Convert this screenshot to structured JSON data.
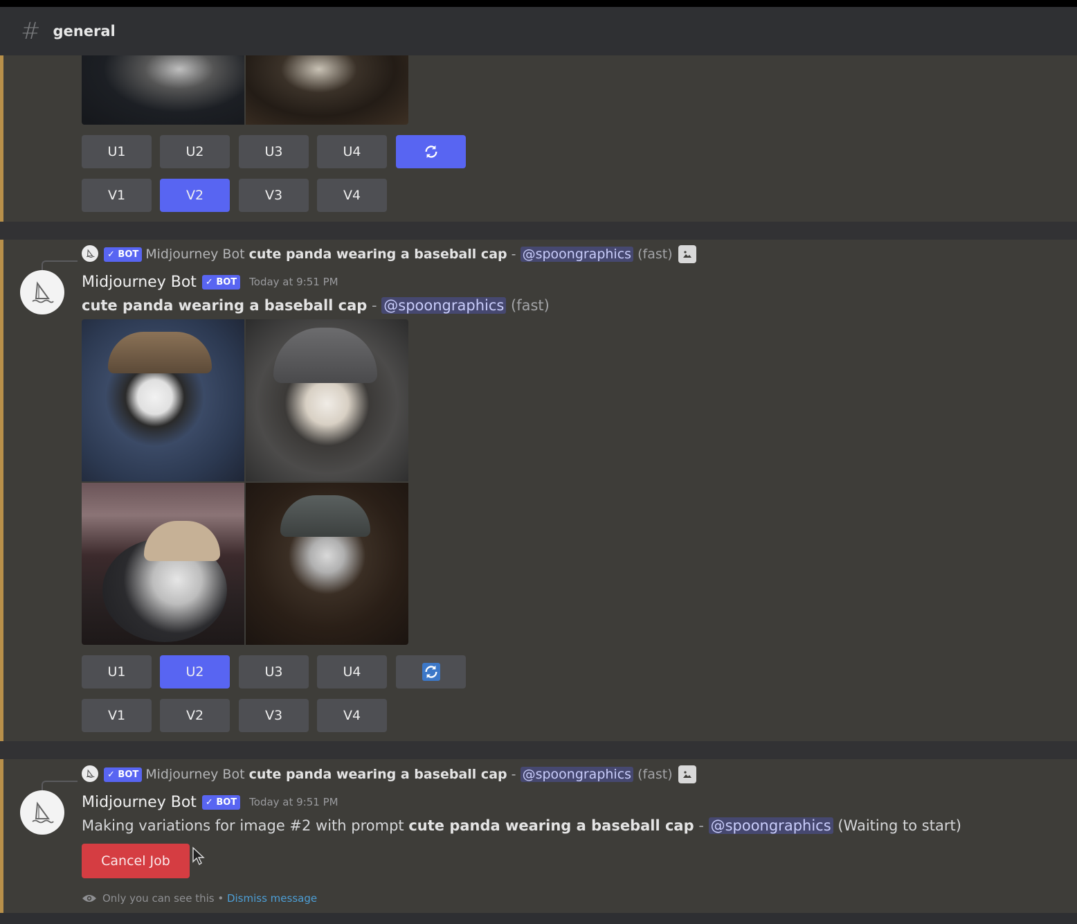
{
  "channel": {
    "name": "general",
    "icon": "hash-icon"
  },
  "colors": {
    "accent": "#5865f2",
    "danger": "#d53d42",
    "mention_text": "#c9cdfb",
    "highlight_bar": "#b8904a",
    "link": "#4d9fd6"
  },
  "messages": [
    {
      "id": "prev",
      "buttons": {
        "upscale": [
          {
            "label": "U1",
            "active": false
          },
          {
            "label": "U2",
            "active": false
          },
          {
            "label": "U3",
            "active": false
          },
          {
            "label": "U4",
            "active": false
          }
        ],
        "reroll": {
          "icon": "refresh-icon",
          "active": true
        },
        "variation": [
          {
            "label": "V1",
            "active": false
          },
          {
            "label": "V2",
            "active": true
          },
          {
            "label": "V3",
            "active": false
          },
          {
            "label": "V4",
            "active": false
          }
        ]
      }
    },
    {
      "id": "grid",
      "reference": {
        "badge": "✓ BOT",
        "author": "Midjourney Bot",
        "prompt": "cute panda wearing a baseball cap",
        "dash": " - ",
        "mention": "@spoongraphics",
        "mode": "(fast)",
        "icon": "image-icon"
      },
      "author": "Midjourney Bot",
      "badge": "✓ BOT",
      "timestamp": "Today at 9:51 PM",
      "prompt": "cute panda wearing a baseball cap",
      "dash": " - ",
      "mention": "@spoongraphics",
      "mode": "(fast)",
      "images": [
        "panda-blue-background-brown-cap",
        "panda-grey-cap-light-fur",
        "panda-window-beige-cap",
        "panda-dark-cap-brown-background"
      ],
      "buttons": {
        "upscale": [
          {
            "label": "U1",
            "active": false
          },
          {
            "label": "U2",
            "active": true
          },
          {
            "label": "U3",
            "active": false
          },
          {
            "label": "U4",
            "active": false
          }
        ],
        "reroll": {
          "icon": "refresh-icon",
          "active": false
        },
        "variation": [
          {
            "label": "V1",
            "active": false
          },
          {
            "label": "V2",
            "active": false
          },
          {
            "label": "V3",
            "active": false
          },
          {
            "label": "V4",
            "active": false
          }
        ]
      }
    },
    {
      "id": "job",
      "reference": {
        "badge": "✓ BOT",
        "author": "Midjourney Bot",
        "prompt": "cute panda wearing a baseball cap",
        "dash": " - ",
        "mention": "@spoongraphics",
        "mode": "(fast)",
        "icon": "image-icon"
      },
      "author": "Midjourney Bot",
      "badge": "✓ BOT",
      "timestamp": "Today at 9:51 PM",
      "intro": "Making variations for image #2 with prompt ",
      "prompt": "cute panda wearing a baseball cap",
      "dash": " - ",
      "mention": "@spoongraphics",
      "status": "(Waiting to start)",
      "cancel_label": "Cancel Job",
      "ephemeral": {
        "text": "Only you can see this • ",
        "link": "Dismiss message",
        "icon": "eye-icon"
      }
    }
  ]
}
